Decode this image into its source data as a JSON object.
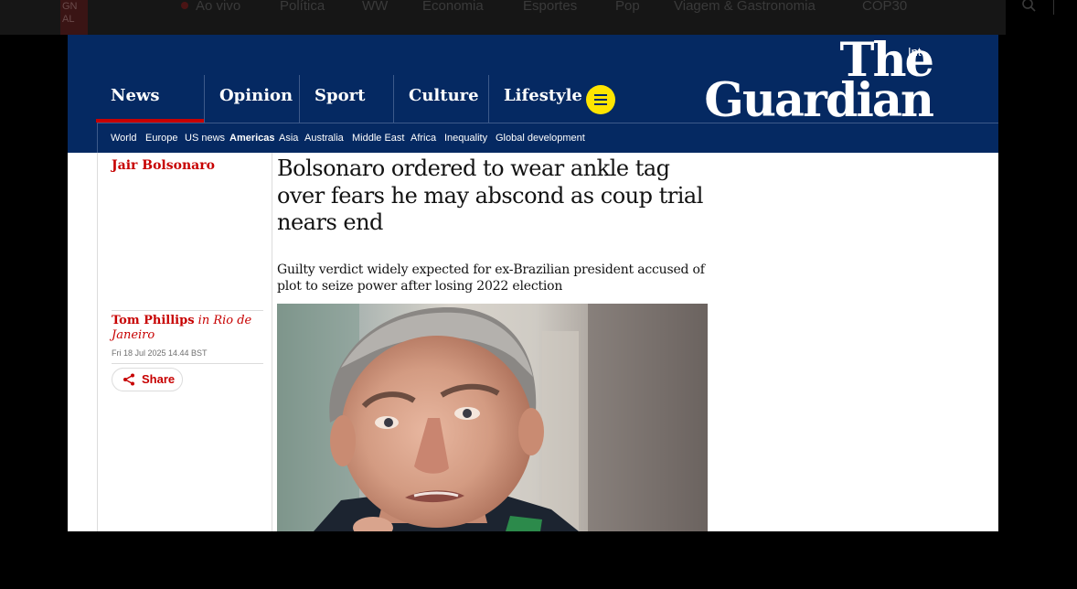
{
  "browser_bar": {
    "logo_fragment": "GN\nAL",
    "nav": [
      "Ao vivo",
      "Política",
      "WW",
      "Economia",
      "Esportes",
      "Pop",
      "Viagem & Gastronomia",
      "COP30"
    ]
  },
  "masthead": {
    "edition": "Int",
    "brand_line1": "The",
    "brand_line2": "Guardian",
    "pillars": [
      "News",
      "Opinion",
      "Sport",
      "Culture",
      "Lifestyle"
    ],
    "active_pillar": "News",
    "subnav": [
      "World",
      "Europe",
      "US news",
      "Americas",
      "Asia",
      "Australia",
      "Middle East",
      "Africa",
      "Inequality",
      "Global development"
    ],
    "active_subnav": "Americas"
  },
  "article": {
    "series": "Jair Bolsonaro",
    "headline": "Bolsonaro ordered to wear ankle tag over fears he may abscond as coup trial nears end",
    "standfirst": "Guilty verdict widely expected for ex-Brazilian president accused of plot to seize power after losing 2022 election",
    "author": "Tom Phillips",
    "location": "in Rio de Janeiro",
    "dateline": "Fri 18 Jul 2025 14.44 BST",
    "share_label": "Share"
  },
  "colors": {
    "masthead": "#052962",
    "accent_red": "#c70000",
    "menu_yellow": "#ffe500"
  }
}
